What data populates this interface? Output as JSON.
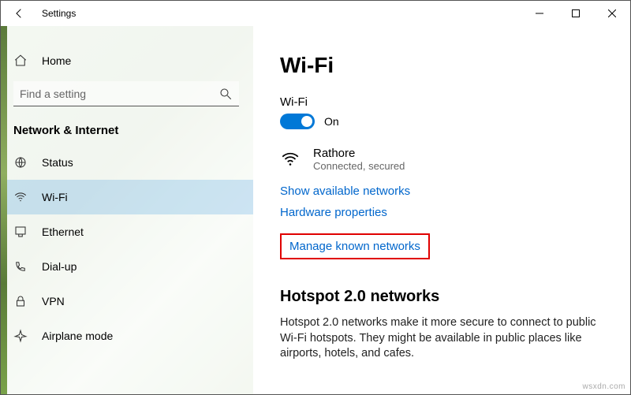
{
  "titlebar": {
    "title": "Settings"
  },
  "sidebar": {
    "home": "Home",
    "search_placeholder": "Find a setting",
    "section": "Network & Internet",
    "items": [
      {
        "label": "Status"
      },
      {
        "label": "Wi-Fi"
      },
      {
        "label": "Ethernet"
      },
      {
        "label": "Dial-up"
      },
      {
        "label": "VPN"
      },
      {
        "label": "Airplane mode"
      }
    ]
  },
  "main": {
    "heading": "Wi-Fi",
    "wifi_label": "Wi-Fi",
    "toggle_state": "On",
    "network": {
      "name": "Rathore",
      "status": "Connected, secured"
    },
    "links": {
      "available": "Show available networks",
      "hardware": "Hardware properties",
      "manage": "Manage known networks"
    },
    "hotspot_heading": "Hotspot 2.0 networks",
    "hotspot_text": "Hotspot 2.0 networks make it more secure to connect to public Wi-Fi hotspots. They might be available in public places like airports, hotels, and cafes."
  },
  "watermark": "wsxdn.com"
}
